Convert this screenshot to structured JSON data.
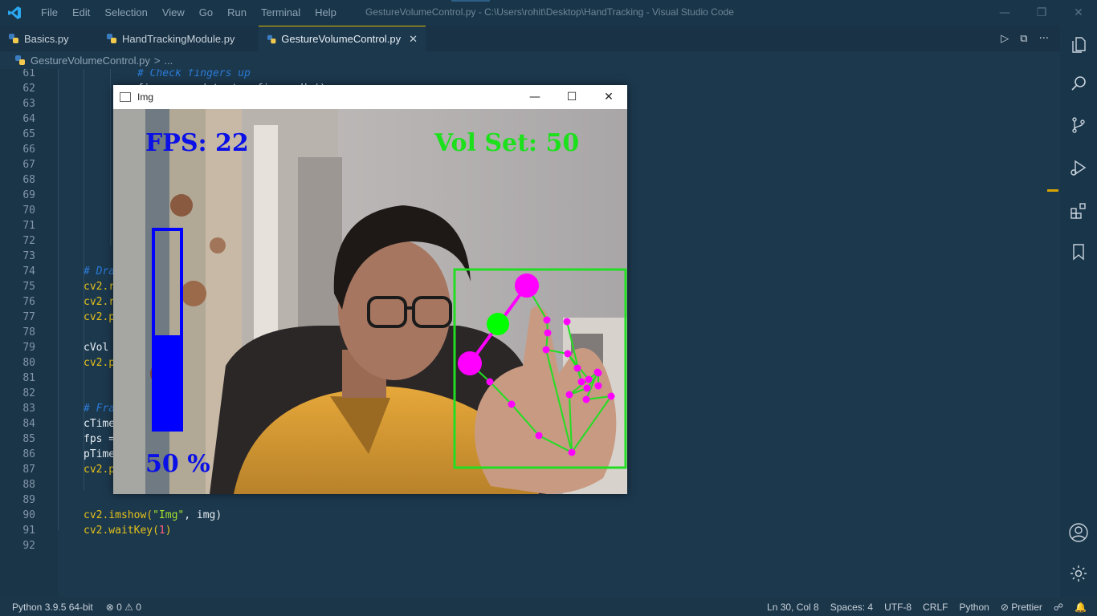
{
  "titlebar": {
    "menu": [
      "File",
      "Edit",
      "Selection",
      "View",
      "Go",
      "Run",
      "Terminal",
      "Help"
    ],
    "title": "GestureVolumeControl.py - C:\\Users\\rohit\\Desktop\\HandTracking - Visual Studio Code",
    "controls": {
      "minimize": "—",
      "restore": "❐",
      "close": "✕"
    }
  },
  "tabs": [
    {
      "label": "Basics.py",
      "active": false
    },
    {
      "label": "HandTrackingModule.py",
      "active": false
    },
    {
      "label": "GestureVolumeControl.py",
      "active": true,
      "close": "✕"
    }
  ],
  "editor_actions": {
    "run": "▷",
    "split": "⧉",
    "more": "···"
  },
  "breadcrumb": {
    "file": "GestureVolumeControl.py",
    "sep": ">",
    "more": "..."
  },
  "editor": {
    "lines": [
      {
        "n": "61",
        "text": "# Check fingers up",
        "type": "comment",
        "indent": 2
      },
      {
        "n": "62",
        "text": "fingers = detector.fingersUp()",
        "type": "var",
        "indent": 2
      },
      {
        "n": "63",
        "text": "",
        "type": "var",
        "indent": 0
      },
      {
        "n": "64",
        "text": "",
        "type": "var",
        "indent": 0
      },
      {
        "n": "65",
        "text": "",
        "type": "var",
        "indent": 0
      },
      {
        "n": "66",
        "text": "",
        "type": "var",
        "indent": 0
      },
      {
        "n": "67",
        "text": "",
        "type": "var",
        "indent": 0
      },
      {
        "n": "68",
        "text": "",
        "type": "var",
        "indent": 0
      },
      {
        "n": "69",
        "text": "",
        "type": "var",
        "indent": 0
      },
      {
        "n": "70",
        "text": "",
        "type": "var",
        "indent": 0
      },
      {
        "n": "71",
        "text": "",
        "type": "var",
        "indent": 0
      },
      {
        "n": "72",
        "text": "",
        "type": "var",
        "indent": 0
      },
      {
        "n": "73",
        "text": "",
        "type": "var",
        "indent": 0
      },
      {
        "n": "74",
        "text": "# Dra",
        "type": "comment",
        "indent": 1
      },
      {
        "n": "75",
        "text": "cv2.r",
        "type": "func",
        "indent": 1
      },
      {
        "n": "76",
        "text": "cv2.r",
        "type": "func",
        "indent": 1
      },
      {
        "n": "77",
        "text": "cv2.p",
        "type": "func",
        "indent": 1
      },
      {
        "n": "78",
        "text": "",
        "type": "var",
        "indent": 0
      },
      {
        "n": "79",
        "text": "cVol",
        "type": "var",
        "indent": 1
      },
      {
        "n": "80",
        "text": "cv2.p",
        "type": "func",
        "indent": 1
      },
      {
        "n": "81",
        "text": "",
        "type": "var",
        "indent": 0
      },
      {
        "n": "82",
        "text": "",
        "type": "var",
        "indent": 0
      },
      {
        "n": "83",
        "text": "# Fra",
        "type": "comment",
        "indent": 1
      },
      {
        "n": "84",
        "text": "cTime",
        "type": "var",
        "indent": 1
      },
      {
        "n": "85",
        "text": "fps =",
        "type": "var",
        "indent": 1
      },
      {
        "n": "86",
        "text": "pTime",
        "type": "var",
        "indent": 1
      },
      {
        "n": "87",
        "text": "cv2.p",
        "type": "func",
        "indent": 1
      },
      {
        "n": "88",
        "text": "",
        "type": "var",
        "indent": 0
      },
      {
        "n": "89",
        "text": "",
        "type": "var",
        "indent": 0
      },
      {
        "n": "90",
        "text": "",
        "type": "show",
        "indent": 1
      },
      {
        "n": "91",
        "text": "",
        "type": "wait",
        "indent": 1
      },
      {
        "n": "92",
        "text": "",
        "type": "var",
        "indent": 0
      }
    ],
    "imshow": {
      "fn": "cv2.imshow(",
      "str": "\"Img\"",
      "rest": ", img)"
    },
    "waitkey": {
      "fn": "cv2.waitKey(",
      "num": "1",
      "rest": ")"
    }
  },
  "cv_window": {
    "title": "Img",
    "controls": {
      "minimize": "—",
      "maximize": "☐",
      "close": "✕"
    },
    "fps_text": "FPS: 22",
    "vol_set_text": "Vol Set: 50",
    "percent_text": "50 %",
    "volume_level": 0.47,
    "colors": {
      "fps": "#0a10e6",
      "vol_set": "#1de01d",
      "bar": "#0000ff",
      "landmark": "#ff00ff",
      "connection": "#22dd22",
      "center": "#00ff00"
    }
  },
  "activity_bar": [
    "explorer-icon",
    "search-icon",
    "source-control-icon",
    "run-debug-icon",
    "extensions-icon",
    "bookmark-icon",
    "account-icon",
    "settings-gear-icon"
  ],
  "status": {
    "python": "Python 3.9.5 64-bit",
    "problems": "⊗ 0 ⚠ 0",
    "position": "Ln 30, Col 8",
    "spaces": "Spaces: 4",
    "encoding": "UTF-8",
    "eol": "CRLF",
    "language": "Python",
    "prettier": "⊘ Prettier",
    "feedback": "☍",
    "notifications": "🔔"
  }
}
